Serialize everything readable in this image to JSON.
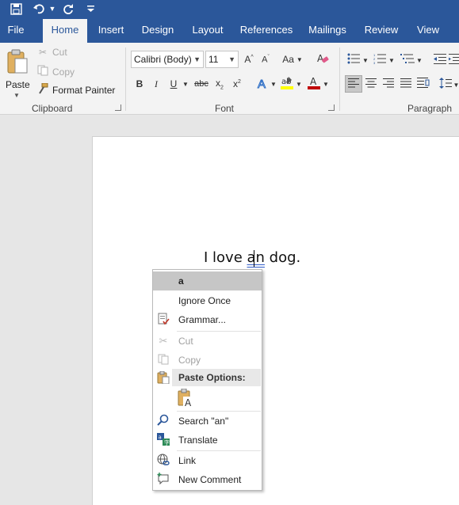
{
  "quick_access": {
    "icons": [
      "save-icon",
      "undo-icon",
      "dropdown-icon",
      "redo-icon",
      "customize-icon"
    ]
  },
  "tabs": [
    {
      "label": "File"
    },
    {
      "label": "Home",
      "active": true
    },
    {
      "label": "Insert"
    },
    {
      "label": "Design"
    },
    {
      "label": "Layout"
    },
    {
      "label": "References"
    },
    {
      "label": "Mailings"
    },
    {
      "label": "Review"
    },
    {
      "label": "View"
    }
  ],
  "clipboard": {
    "paste_label": "Paste",
    "cut_label": "Cut",
    "copy_label": "Copy",
    "format_painter_label": "Format Painter",
    "group_label": "Clipboard"
  },
  "font": {
    "font_name": "Calibri (Body)",
    "font_size": "11",
    "change_case": "Aa",
    "group_label": "Font"
  },
  "paragraph": {
    "group_label": "Paragraph"
  },
  "document": {
    "before": "I love ",
    "misspelled": "an",
    "after": " dog."
  },
  "context_menu": {
    "suggestion": "a",
    "ignore_once": "Ignore Once",
    "grammar": "Grammar...",
    "cut": "Cut",
    "copy": "Copy",
    "paste_options": "Paste Options:",
    "search": "Search \"an\"",
    "translate": "Translate",
    "link": "Link",
    "new_comment": "New Comment"
  },
  "colors": {
    "brand": "#2b579a",
    "underline": "#2f5bc8",
    "highlight": "#ffff00",
    "font_color": "#c00000"
  }
}
